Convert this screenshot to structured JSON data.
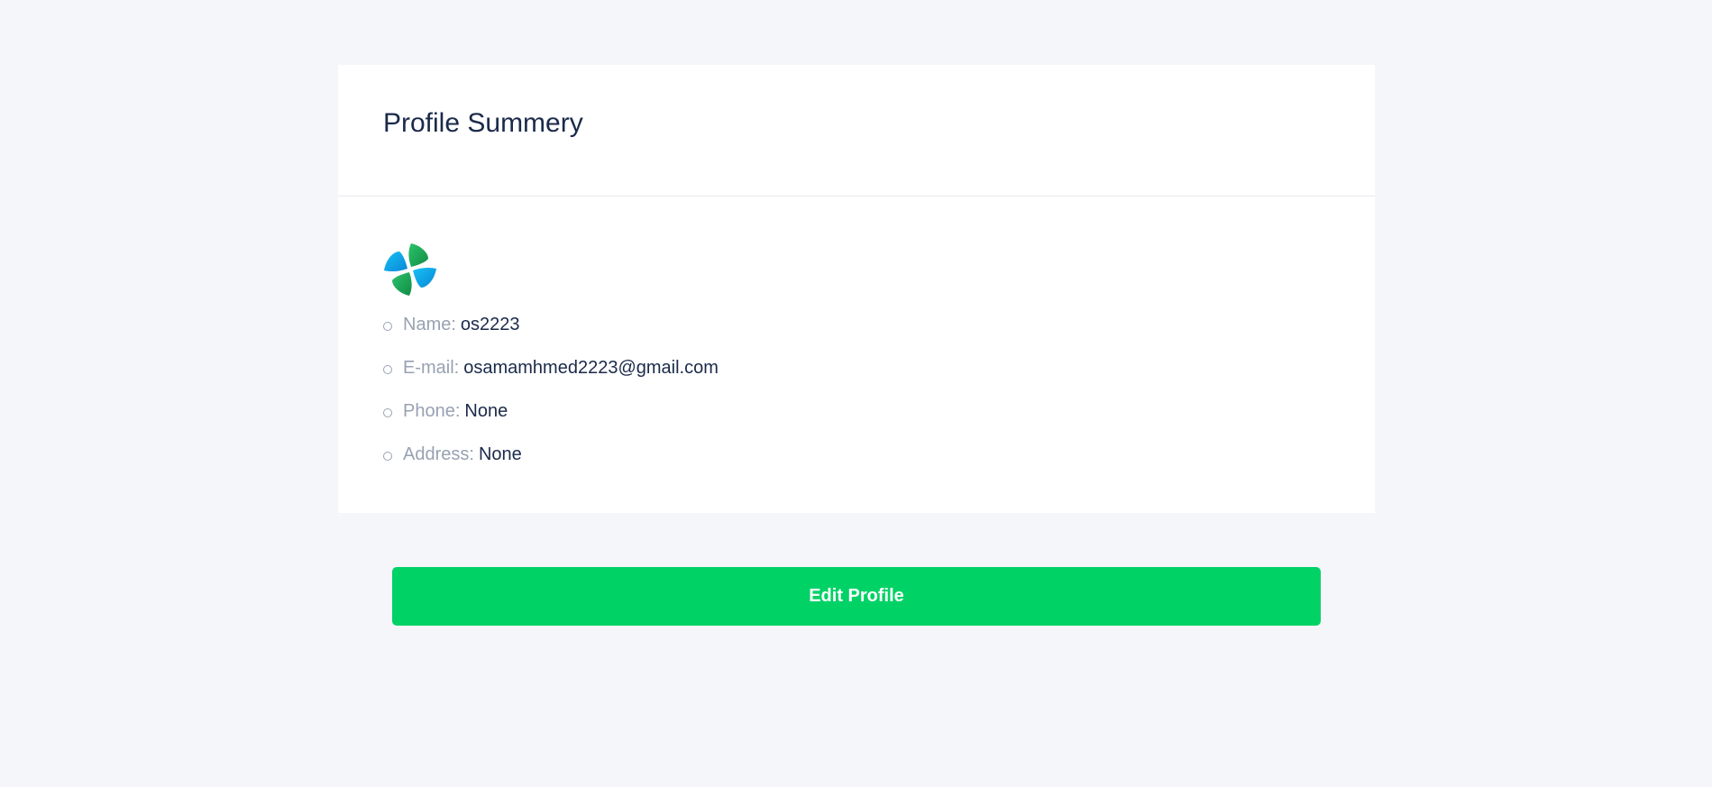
{
  "profile": {
    "title": "Profile Summery",
    "logo_icon": "four-petal-logo-icon",
    "fields": [
      {
        "label": "Name:",
        "value": "os2223"
      },
      {
        "label": "E-mail:",
        "value": "osamamhmed2223@gmail.com"
      },
      {
        "label": "Phone:",
        "value": "None"
      },
      {
        "label": "Address:",
        "value": "None"
      }
    ]
  },
  "actions": {
    "edit_label": "Edit Profile"
  },
  "colors": {
    "background": "#f4f6fa",
    "accent_green": "#00d266",
    "logo_blue": "#11a7e6",
    "logo_green": "#1aa957",
    "title_text": "#1b2a4a",
    "label_text": "#98a1b2"
  }
}
